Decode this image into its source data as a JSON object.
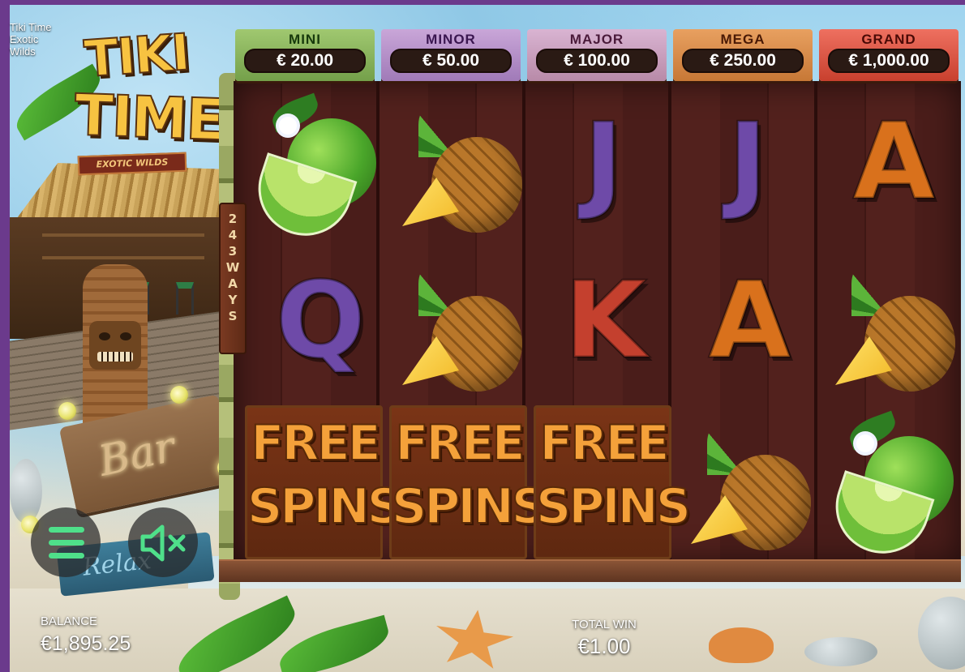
{
  "game": {
    "name_lines": [
      "Tiki Time",
      "Exotic",
      "Wilds"
    ],
    "logo": {
      "line1": "TIKI",
      "line2": "TIME",
      "subtitle": "EXOTIC WILDS"
    },
    "ways_label": [
      "2",
      "4",
      "3",
      "W",
      "A",
      "Y",
      "S"
    ]
  },
  "jackpots": [
    {
      "label": "MINI",
      "value": "€ 20.00",
      "color": "#8ab85c"
    },
    {
      "label": "MINOR",
      "value": "€ 50.00",
      "color": "#b48fcb"
    },
    {
      "label": "MAJOR",
      "value": "€ 100.00",
      "color": "#c99fbd"
    },
    {
      "label": "MEGA",
      "value": "€ 250.00",
      "color": "#d98c4a"
    },
    {
      "label": "GRAND",
      "value": "€ 1,000.00",
      "color": "#dc5444"
    }
  ],
  "reels": [
    [
      "lime",
      "Q",
      "free-spins"
    ],
    [
      "pineapple",
      "pineapple",
      "free-spins"
    ],
    [
      "J",
      "K",
      "free-spins"
    ],
    [
      "J",
      "A",
      "pineapple"
    ],
    [
      "A",
      "pineapple",
      "lime"
    ]
  ],
  "free_spins_label": {
    "line1": "FREE",
    "line2": "SPINS"
  },
  "scenery": {
    "bar_sign": "Bar",
    "relax_sign": "Relax"
  },
  "hud": {
    "balance_label": "BALANCE",
    "balance_value": "€1,895.25",
    "total_win_label": "TOTAL WIN",
    "total_win_value": "€1.00"
  },
  "controls": {
    "menu_icon": "hamburger-menu-icon",
    "sound_icon": "speaker-muted-icon",
    "accent_color": "#4fe08a"
  }
}
